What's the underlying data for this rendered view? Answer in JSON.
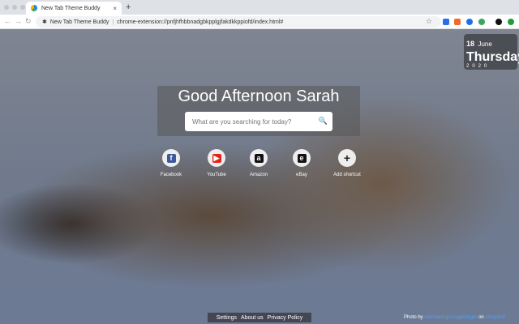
{
  "browser": {
    "tab_title": "New Tab Theme Buddy",
    "omnibox_site": "New Tab Theme Buddy",
    "url": "chrome-extension://pnfjhfhbbnadgbkpplgjfakdkkppiofd/index.html#",
    "new_tab": "+",
    "close": "×"
  },
  "date": {
    "day": "18",
    "month": "June",
    "weekday": "Thursday",
    "year": "2020"
  },
  "greeting": "Good Afternoon Sarah",
  "search": {
    "placeholder": "What are you searching for today?"
  },
  "shortcuts": [
    {
      "label": "Facebook",
      "glyph": "f",
      "color": "#3b5998"
    },
    {
      "label": "YouTube",
      "glyph": "▶",
      "color": "#e62117"
    },
    {
      "label": "Amazon",
      "glyph": "a",
      "color": "#111111"
    },
    {
      "label": "eBay",
      "glyph": "e",
      "color": "#111111"
    },
    {
      "label": "Add shortcut",
      "glyph": "+",
      "color": "#222222"
    }
  ],
  "footer": {
    "links": [
      "Settings",
      "About us",
      "Privacy Policy"
    ]
  },
  "credit": {
    "prefix": "Photo by",
    "author": "eberhard grossgasteiger",
    "on": "on",
    "site": "Unsplash"
  }
}
